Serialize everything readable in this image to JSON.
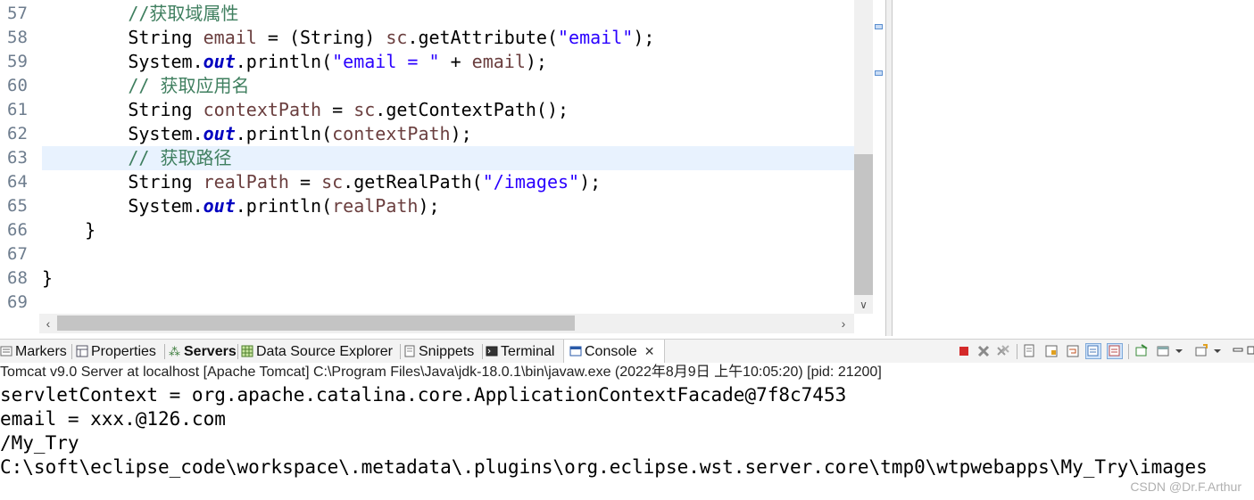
{
  "editor": {
    "line_numbers": [
      "57",
      "58",
      "59",
      "60",
      "61",
      "62",
      "63",
      "64",
      "65",
      "66",
      "67",
      "68",
      "69"
    ],
    "current_line_index": 6,
    "lines": [
      [
        {
          "t": "        "
        },
        {
          "c": "cm",
          "t": "//获取域属性"
        }
      ],
      [
        {
          "t": "        String "
        },
        {
          "c": "vr",
          "t": "email"
        },
        {
          "t": " = (String) "
        },
        {
          "c": "vr",
          "t": "sc"
        },
        {
          "t": ".getAttribute("
        },
        {
          "c": "st",
          "t": "\"email\""
        },
        {
          "t": ");"
        }
      ],
      [
        {
          "t": "        System."
        },
        {
          "c": "fd",
          "t": "out"
        },
        {
          "t": ".println("
        },
        {
          "c": "st",
          "t": "\"email = \""
        },
        {
          "t": " + "
        },
        {
          "c": "vr",
          "t": "email"
        },
        {
          "t": ");"
        }
      ],
      [
        {
          "t": "        "
        },
        {
          "c": "cm",
          "t": "// 获取应用名"
        }
      ],
      [
        {
          "t": "        String "
        },
        {
          "c": "vr",
          "t": "contextPath"
        },
        {
          "t": " = "
        },
        {
          "c": "vr",
          "t": "sc"
        },
        {
          "t": ".getContextPath();"
        }
      ],
      [
        {
          "t": "        System."
        },
        {
          "c": "fd",
          "t": "out"
        },
        {
          "t": ".println("
        },
        {
          "c": "vr",
          "t": "contextPath"
        },
        {
          "t": ");"
        }
      ],
      [
        {
          "t": "        "
        },
        {
          "c": "cm",
          "t": "// 获取路径"
        }
      ],
      [
        {
          "t": "        String "
        },
        {
          "c": "vr",
          "t": "realPath"
        },
        {
          "t": " = "
        },
        {
          "c": "vr",
          "t": "sc"
        },
        {
          "t": ".getRealPath("
        },
        {
          "c": "st",
          "t": "\"/images\""
        },
        {
          "t": ");"
        }
      ],
      [
        {
          "t": "        System."
        },
        {
          "c": "fd",
          "t": "out"
        },
        {
          "t": ".println("
        },
        {
          "c": "vr",
          "t": "realPath"
        },
        {
          "t": ");"
        }
      ],
      [
        {
          "t": "    }"
        }
      ],
      [
        {
          "t": ""
        }
      ],
      [
        {
          "t": "}"
        }
      ],
      [
        {
          "t": ""
        }
      ]
    ]
  },
  "views": {
    "tabs": [
      {
        "id": "markers",
        "label": "Markers",
        "icon": "markers-icon"
      },
      {
        "id": "properties",
        "label": "Properties",
        "icon": "properties-icon"
      },
      {
        "id": "servers",
        "label": "Servers",
        "icon": "servers-icon"
      },
      {
        "id": "datasource",
        "label": "Data Source Explorer",
        "icon": "database-icon"
      },
      {
        "id": "snippets",
        "label": "Snippets",
        "icon": "snippets-icon"
      },
      {
        "id": "terminal",
        "label": "Terminal",
        "icon": "terminal-icon"
      },
      {
        "id": "console",
        "label": "Console",
        "icon": "console-icon"
      }
    ],
    "close_glyph": "✕",
    "toolbar_icons": [
      "terminate-icon",
      "remove-launch-icon",
      "remove-all-icon",
      "clear-console-icon",
      "scroll-lock-icon",
      "word-wrap-icon",
      "show-on-stdout-icon",
      "show-on-stderr-icon",
      "pin-console-icon",
      "display-console-icon",
      "dropdown-icon",
      "open-console-icon",
      "dropdown-icon",
      "minimize-icon",
      "maximize-icon"
    ]
  },
  "console": {
    "launch_info": "Tomcat v9.0 Server at localhost [Apache Tomcat] C:\\Program Files\\Java\\jdk-18.0.1\\bin\\javaw.exe  (2022年8月9日 上午10:05:20) [pid: 21200]",
    "output": [
      "servletContext = org.apache.catalina.core.ApplicationContextFacade@7f8c7453",
      "email = xxx.@126.com",
      "/My_Try",
      "C:\\soft\\eclipse_code\\workspace\\.metadata\\.plugins\\org.eclipse.wst.server.core\\tmp0\\wtpwebapps\\My_Try\\images"
    ],
    "watermark": "CSDN @Dr.F.Arthur"
  },
  "colors": {
    "comment": "#3f7f5f",
    "variable": "#6a3e3e",
    "string": "#2a00ff",
    "field": "#0000c0",
    "highlight": "#e8f2fe"
  }
}
